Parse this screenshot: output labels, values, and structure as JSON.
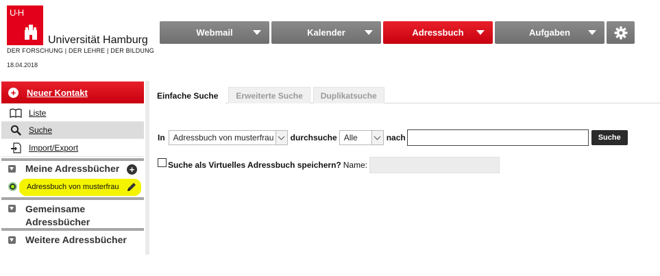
{
  "logo": {
    "mark_text": "U·H",
    "name": "Universität Hamburg",
    "tagline": "DER FORSCHUNG | DER LEHRE | DER BILDUNG",
    "brand_color": "#e2001a"
  },
  "date": "18.04.2018",
  "topnav": {
    "items": [
      {
        "label": "Webmail",
        "active": false
      },
      {
        "label": "Kalender",
        "active": false
      },
      {
        "label": "Adressbuch",
        "active": true
      },
      {
        "label": "Aufgaben",
        "active": false
      }
    ],
    "settings_icon": "gear-icon"
  },
  "sidebar": {
    "new_contact_label": "Neuer Kontakt",
    "links": [
      {
        "label": "Liste",
        "icon": "book-open-icon"
      },
      {
        "label": "Suche",
        "icon": "search-icon",
        "active": true
      },
      {
        "label": "Import/Export",
        "icon": "import-export-icon"
      }
    ],
    "sections": {
      "mine": "Meine Adressbücher",
      "shared": "Gemeinsame Adressbücher",
      "further": "Weitere Adressbücher"
    },
    "address_book": "Adressbuch von musterfrau",
    "highlight_color": "#f4f400"
  },
  "main": {
    "tabs": [
      {
        "label": "Einfache Suche",
        "active": true
      },
      {
        "label": "Erweiterte Suche",
        "active": false
      },
      {
        "label": "Duplikatsuche",
        "active": false
      }
    ],
    "search": {
      "in_label": "In",
      "book_select_value": "Adressbuch von musterfrau",
      "durchsuche_label": "durchsuche",
      "field_select_value": "Alle",
      "nach_label": "nach",
      "query_value": "",
      "button_label": "Suche"
    },
    "save": {
      "checkbox_label": "Suche als Virtuelles Adressbuch speichern?",
      "name_label": "Name:",
      "name_value": ""
    }
  }
}
